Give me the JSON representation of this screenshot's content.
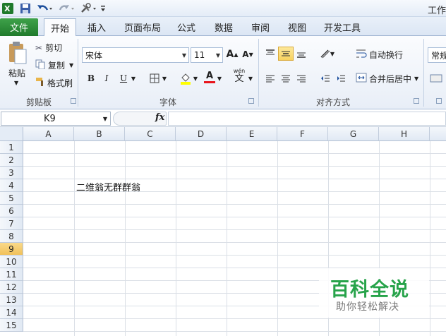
{
  "titlebar": {
    "title": "工作"
  },
  "tabs": {
    "file": "文件",
    "items": [
      "开始",
      "插入",
      "页面布局",
      "公式",
      "数据",
      "审阅",
      "视图",
      "开发工具"
    ]
  },
  "clipboard": {
    "paste": "粘贴",
    "cut": "剪切",
    "copy": "复制",
    "format_painter": "格式刷",
    "label": "剪贴板"
  },
  "font": {
    "name": "宋体",
    "size": "11",
    "label": "字体",
    "bold": "B",
    "italic": "I",
    "underline": "U",
    "grow": "A",
    "shrink": "A",
    "font_color": "A",
    "phonetic": "wén",
    "phonetic_char": "文"
  },
  "alignment": {
    "wrap": "自动换行",
    "merge": "合并后居中",
    "label": "对齐方式"
  },
  "number": {
    "format": "常规"
  },
  "formula_bar": {
    "name_box": "K9",
    "fx": "fx"
  },
  "grid": {
    "columns": [
      "A",
      "B",
      "C",
      "D",
      "E",
      "F",
      "G",
      "H"
    ],
    "rows": [
      "1",
      "2",
      "3",
      "4",
      "5",
      "6",
      "7",
      "8",
      "9",
      "10",
      "11",
      "12",
      "13",
      "14",
      "15"
    ],
    "selected_row": "9",
    "cells": {
      "B4": "二维翁无群群翁"
    }
  },
  "watermark": {
    "title": "百科全说",
    "subtitle": "助你轻松解决"
  },
  "colors": {
    "file_tab": "#1f7a2c",
    "selection": "#f1c15a",
    "watermark": "#27a34a"
  }
}
